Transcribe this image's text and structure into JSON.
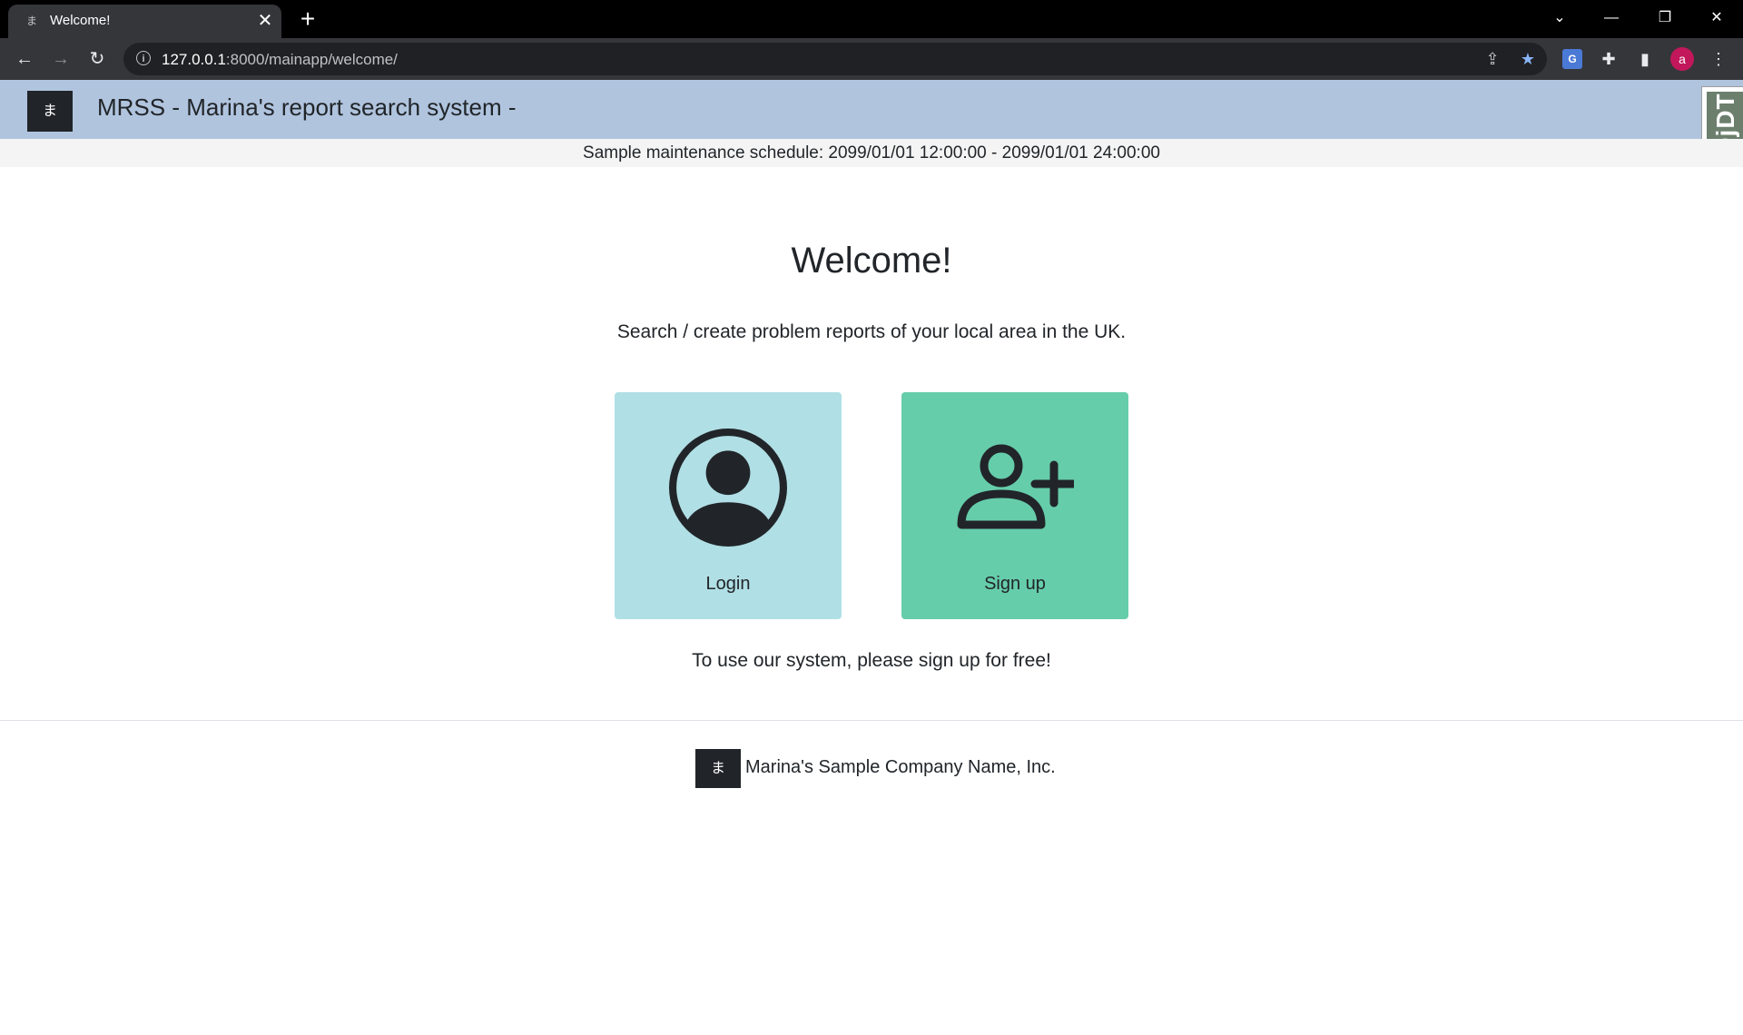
{
  "browser": {
    "tab": {
      "favicon": "ま",
      "title": "Welcome!",
      "close_glyph": "✕"
    },
    "new_tab_glyph": "+",
    "window_controls": {
      "tab_search": "⌄",
      "minimize": "—",
      "restore": "❐",
      "close": "✕"
    },
    "nav": {
      "back": "←",
      "forward": "→",
      "reload": "↻"
    },
    "omnibox": {
      "host": "127.0.0.1",
      "path": ":8000/mainapp/welcome/",
      "info_glyph": "i"
    },
    "toolbar_icons": {
      "share": "⇪",
      "bookmark": "★",
      "translate": "G",
      "extensions": "✚",
      "side_panel": "▮",
      "menu": "⋮"
    },
    "profile_initial": "a"
  },
  "header": {
    "logo_glyph": "ま",
    "title": "MRSS - Marina's report search system -"
  },
  "debug_toolbar": {
    "label": "DjDT"
  },
  "notice": "Sample maintenance schedule: 2099/01/01 12:00:00 - 2099/01/01 24:00:00",
  "main": {
    "title": "Welcome!",
    "subtitle": "Search / create problem reports of your local area in the UK.",
    "cards": {
      "login": {
        "label": "Login",
        "icon": "person-circle-icon",
        "color": "#b0dfe5"
      },
      "signup": {
        "label": "Sign up",
        "icon": "person-plus-icon",
        "color": "#66cdaa"
      }
    },
    "signup_note": "To use our system, please sign up for free!"
  },
  "footer": {
    "logo_glyph": "ま",
    "company": "Marina's Sample Company Name, Inc."
  },
  "colors": {
    "header_bg": "#b0c4de",
    "notice_bg": "#f4f4f4",
    "text": "#212529"
  }
}
